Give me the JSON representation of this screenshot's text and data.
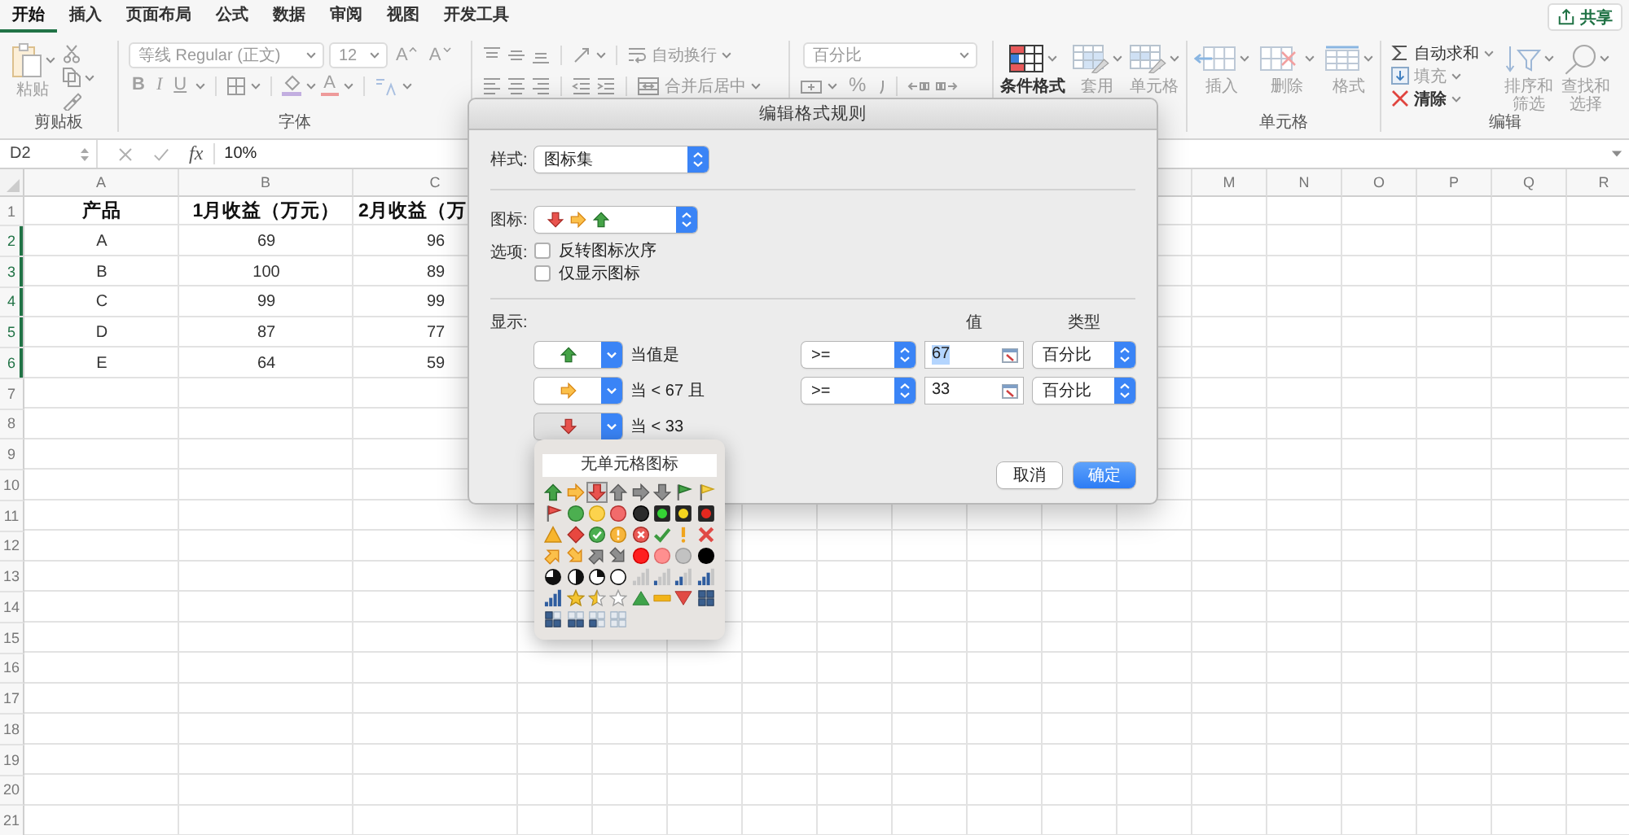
{
  "ribbon": {
    "tabs": [
      {
        "label": "开始",
        "selected": true
      },
      {
        "label": "插入",
        "selected": false
      },
      {
        "label": "页面布局",
        "selected": false
      },
      {
        "label": "公式",
        "selected": false
      },
      {
        "label": "数据",
        "selected": false
      },
      {
        "label": "审阅",
        "selected": false
      },
      {
        "label": "视图",
        "selected": false
      },
      {
        "label": "开发工具",
        "selected": false
      }
    ],
    "share_button": "共享",
    "clipboard": {
      "paste": "粘贴",
      "group_label": "剪贴板"
    },
    "font": {
      "font_name": "等线 Regular (正文)",
      "font_size": "12",
      "grow": "A",
      "shrink": "A",
      "bold": "B",
      "italic": "I",
      "underline": "U",
      "font_color": "A",
      "group_label": "字体"
    },
    "alignment": {
      "wrap_text": "自动换行",
      "merge": "合并后居中"
    },
    "number": {
      "format": "百分比",
      "percent": "%"
    },
    "styles": {
      "conditional_formatting": {
        "label": "条件格式",
        "disabled": false
      },
      "format_as_table": {
        "label": "套用",
        "disabled": true
      },
      "cell_styles": {
        "label": "单元格",
        "disabled": true
      }
    },
    "cells": {
      "insert": {
        "label": "插入",
        "disabled": true
      },
      "delete": {
        "label": "删除",
        "disabled": true
      },
      "format": {
        "label": "格式",
        "disabled": true
      },
      "group_label": "单元格"
    },
    "editing": {
      "autosum": {
        "label": "自动求和",
        "disabled": false
      },
      "fill": {
        "label": "填充",
        "disabled": true
      },
      "clear": {
        "label": "清除",
        "disabled": false
      },
      "sort_filter": {
        "label": "排序和筛选",
        "disabled": true
      },
      "find_select": {
        "label": "查找和选择",
        "disabled": true
      },
      "group_label": "编辑"
    }
  },
  "formula_bar": {
    "name_box": "D2",
    "fx": "fx",
    "value": "10%"
  },
  "sheet": {
    "left_columns": [
      "A",
      "B",
      "C"
    ],
    "right_columns": [
      "M",
      "N",
      "O",
      "P",
      "Q",
      "R"
    ],
    "header_row": {
      "label": "1",
      "selected": false,
      "cells": [
        "产品",
        "1月收益（万元）",
        "2月收益（万"
      ]
    },
    "rows": [
      {
        "label": "2",
        "selected": true,
        "cells": [
          "A",
          "69",
          "96"
        ]
      },
      {
        "label": "3",
        "selected": true,
        "cells": [
          "B",
          "100",
          "89"
        ]
      },
      {
        "label": "4",
        "selected": true,
        "cells": [
          "C",
          "99",
          "99"
        ]
      },
      {
        "label": "5",
        "selected": true,
        "cells": [
          "D",
          "87",
          "77"
        ]
      },
      {
        "label": "6",
        "selected": true,
        "cells": [
          "E",
          "64",
          "59"
        ]
      },
      {
        "label": "7",
        "selected": false
      },
      {
        "label": "8",
        "selected": false
      },
      {
        "label": "9",
        "selected": false
      },
      {
        "label": "10",
        "selected": false
      },
      {
        "label": "11",
        "selected": false
      },
      {
        "label": "12",
        "selected": false
      },
      {
        "label": "13",
        "selected": false
      },
      {
        "label": "14",
        "selected": false
      },
      {
        "label": "15",
        "selected": false
      },
      {
        "label": "16",
        "selected": false
      },
      {
        "label": "17",
        "selected": false
      },
      {
        "label": "18",
        "selected": false
      },
      {
        "label": "19",
        "selected": false
      },
      {
        "label": "20",
        "selected": false
      },
      {
        "label": "21",
        "selected": false
      }
    ]
  },
  "dialog": {
    "title": "编辑格式规则",
    "style": {
      "label": "样式:",
      "value": "图标集"
    },
    "icon_style": {
      "label": "图标:"
    },
    "options": {
      "label": "选项:",
      "items": [
        {
          "label": "反转图标次序",
          "checked": false
        },
        {
          "label": "仅显示图标",
          "checked": false
        }
      ]
    },
    "display": {
      "label": "显示:",
      "value_header": "值",
      "type_header": "类型",
      "rules": [
        {
          "condition": "当值是",
          "operator": ">=",
          "value": "67",
          "value_highlighted": true,
          "type": "百分比",
          "expanded": false
        },
        {
          "condition": "当 < 67 且",
          "operator": ">=",
          "value": "33",
          "value_highlighted": false,
          "type": "百分比",
          "expanded": false
        },
        {
          "condition": "当 < 33",
          "expanded": true
        }
      ]
    },
    "icon_picker": {
      "none_option": "无单元格图标",
      "icons": [
        {
          "kind": "arrow-up-green",
          "selected": false
        },
        {
          "kind": "arrow-right-orange",
          "selected": false
        },
        {
          "kind": "arrow-down-red",
          "selected": true
        },
        {
          "kind": "arrow-up-gray",
          "selected": false
        },
        {
          "kind": "arrow-right-gray",
          "selected": false
        },
        {
          "kind": "arrow-down-gray",
          "selected": false
        },
        {
          "kind": "flag-green",
          "selected": false
        },
        {
          "kind": "flag-yellow",
          "selected": false
        },
        {
          "kind": "flag-red",
          "selected": false
        },
        {
          "kind": "circle-green",
          "selected": false
        },
        {
          "kind": "circle-yellow",
          "selected": false
        },
        {
          "kind": "circle-red",
          "selected": false
        },
        {
          "kind": "circle-black",
          "selected": false
        },
        {
          "kind": "light-green",
          "selected": false
        },
        {
          "kind": "light-yellow",
          "selected": false
        },
        {
          "kind": "light-red",
          "selected": false
        },
        {
          "kind": "triangle-yellow",
          "selected": false
        },
        {
          "kind": "diamond-red",
          "selected": false
        },
        {
          "kind": "check-circle",
          "selected": false
        },
        {
          "kind": "exclaim-circle",
          "selected": false
        },
        {
          "kind": "cross-circle",
          "selected": false
        },
        {
          "kind": "check",
          "selected": false
        },
        {
          "kind": "exclaim",
          "selected": false
        },
        {
          "kind": "cross",
          "selected": false
        },
        {
          "kind": "arrow-upright-orange",
          "selected": false
        },
        {
          "kind": "arrow-downright-orange",
          "selected": false
        },
        {
          "kind": "arrow-upright-gray",
          "selected": false
        },
        {
          "kind": "arrow-downright-gray",
          "selected": false
        },
        {
          "kind": "dot-red",
          "selected": false
        },
        {
          "kind": "dot-pink",
          "selected": false
        },
        {
          "kind": "dot-gray",
          "selected": false
        },
        {
          "kind": "dot-black",
          "selected": false
        },
        {
          "kind": "pie-3",
          "selected": false
        },
        {
          "kind": "pie-2",
          "selected": false
        },
        {
          "kind": "pie-1",
          "selected": false
        },
        {
          "kind": "pie-0",
          "selected": false
        },
        {
          "kind": "bars-0",
          "selected": false
        },
        {
          "kind": "bars-1",
          "selected": false
        },
        {
          "kind": "bars-2",
          "selected": false
        },
        {
          "kind": "bars-3",
          "selected": false
        },
        {
          "kind": "bars-4",
          "selected": false
        },
        {
          "kind": "star-full",
          "selected": false
        },
        {
          "kind": "star-half",
          "selected": false
        },
        {
          "kind": "star-empty",
          "selected": false
        },
        {
          "kind": "tri-up",
          "selected": false
        },
        {
          "kind": "dash",
          "selected": false
        },
        {
          "kind": "tri-down",
          "selected": false
        },
        {
          "kind": "boxes-4",
          "selected": false
        },
        {
          "kind": "boxes-3",
          "selected": false
        },
        {
          "kind": "boxes-2",
          "selected": false
        },
        {
          "kind": "boxes-1",
          "selected": false
        },
        {
          "kind": "boxes-0",
          "selected": false
        }
      ]
    },
    "buttons": [
      {
        "label": "取消",
        "default": false
      },
      {
        "label": "确定",
        "default": true
      }
    ]
  }
}
